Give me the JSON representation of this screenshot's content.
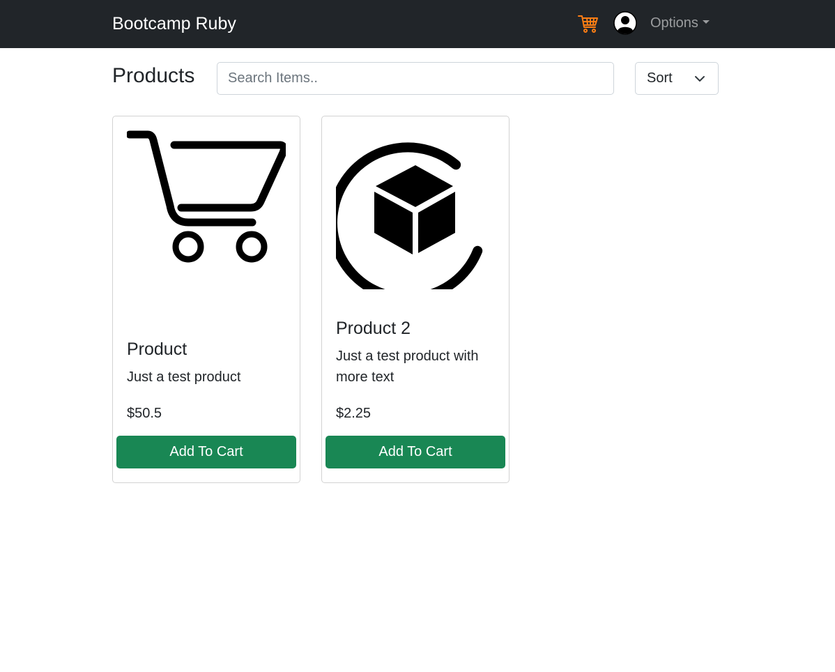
{
  "navbar": {
    "brand": "Bootcamp Ruby",
    "cart_icon": "shopping-cart-icon",
    "avatar_icon": "user-avatar-icon",
    "options_label": "Options",
    "cart_icon_color": "#fd7e14"
  },
  "header": {
    "title": "Products",
    "search_placeholder": "Search Items..",
    "search_value": "",
    "sort_label": "Sort"
  },
  "products": [
    {
      "image_icon": "shopping-cart-icon",
      "name": "Product",
      "description": "Just a test product",
      "price": "$50.5",
      "button_label": "Add To Cart"
    },
    {
      "image_icon": "package-box-icon",
      "name": "Product 2",
      "description": "Just a test product with more text",
      "price": "$2.25",
      "button_label": "Add To Cart"
    }
  ],
  "colors": {
    "navbar_bg": "#212529",
    "button_bg": "#198754"
  }
}
